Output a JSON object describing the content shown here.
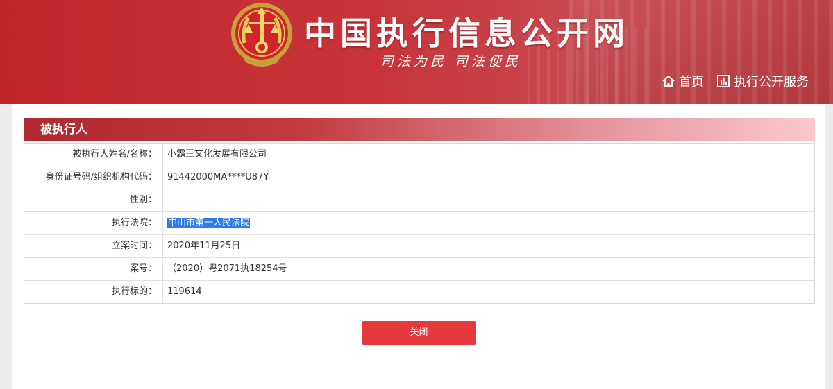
{
  "header": {
    "site_title": "中国执行信息公开网",
    "slogan": "司法为民  司法便民",
    "nav": [
      {
        "label": "首页",
        "icon": "home-icon"
      },
      {
        "label": "执行公开服务",
        "icon": "chart-icon"
      }
    ]
  },
  "section": {
    "title": "被执行人",
    "rows": [
      {
        "label": "被执行人姓名/名称：",
        "value": "小霸王文化发展有限公司"
      },
      {
        "label": "身份证号码/组织机构代码：",
        "value": "91442000MA****U87Y"
      },
      {
        "label": "性别：",
        "value": ""
      },
      {
        "label": "执行法院：",
        "value": "中山市第一人民法院",
        "selected": true
      },
      {
        "label": "立案时间：",
        "value": "2020年11月25日"
      },
      {
        "label": "案号：",
        "value": "（2020）粤2071执18254号"
      },
      {
        "label": "执行标的：",
        "value": "119614"
      }
    ]
  },
  "close_label": "关闭",
  "colors": {
    "header_red": "#c0272d",
    "button_red": "#e5393e",
    "selection_blue": "#2f7be8"
  }
}
